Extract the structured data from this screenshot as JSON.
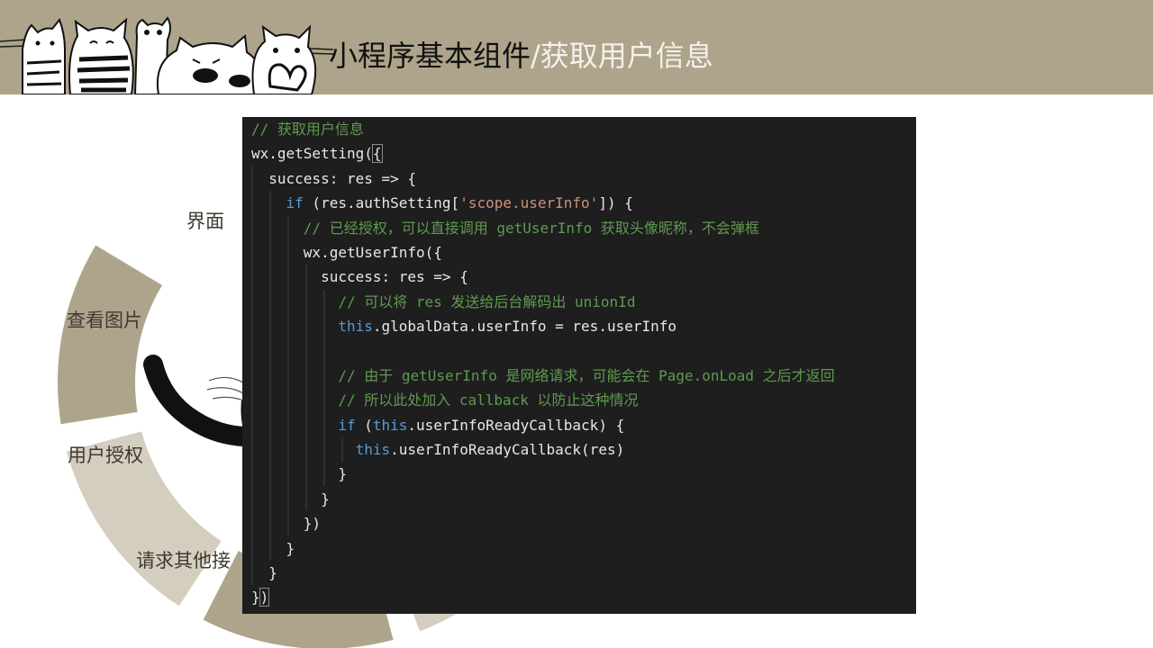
{
  "header": {
    "title_main": "小程序基本组件",
    "title_sep": "/",
    "title_sub": "获取用户信息"
  },
  "ring": {
    "segments": [
      {
        "label": "界面",
        "color": "#d4cebf"
      },
      {
        "label": "查看图片",
        "color": "#ada48b"
      },
      {
        "label": "用户授权",
        "color": "#d4cebf"
      },
      {
        "label": "请求其他接",
        "color": "#ada48b"
      }
    ]
  },
  "code": {
    "lines": [
      [
        {
          "t": "// 获取用户信息",
          "c": "comment"
        }
      ],
      [
        {
          "t": "wx.getSetting(",
          "c": "id"
        },
        {
          "t": "{",
          "c": "id"
        }
      ],
      [
        {
          "t": "  success: res => {",
          "c": "id"
        }
      ],
      [
        {
          "t": "    ",
          "c": "plain"
        },
        {
          "t": "if",
          "c": "kw"
        },
        {
          "t": " (res.authSetting[",
          "c": "id"
        },
        {
          "t": "'scope.userInfo'",
          "c": "str"
        },
        {
          "t": "]) {",
          "c": "id"
        }
      ],
      [
        {
          "t": "      // 已经授权，可以直接调用 getUserInfo 获取头像昵称，不会弹框",
          "c": "comment"
        }
      ],
      [
        {
          "t": "      wx.getUserInfo({",
          "c": "id"
        }
      ],
      [
        {
          "t": "        success: res => {",
          "c": "id"
        }
      ],
      [
        {
          "t": "          // 可以将 res 发送给后台解码出 unionId",
          "c": "comment"
        }
      ],
      [
        {
          "t": "          ",
          "c": "plain"
        },
        {
          "t": "this",
          "c": "kw"
        },
        {
          "t": ".globalData.userInfo = res.userInfo",
          "c": "id"
        }
      ],
      [
        {
          "t": "",
          "c": "plain"
        }
      ],
      [
        {
          "t": "          // 由于 getUserInfo 是网络请求，可能会在 Page.onLoad 之后才返回",
          "c": "comment"
        }
      ],
      [
        {
          "t": "          // 所以此处加入 callback 以防止这种情况",
          "c": "comment"
        }
      ],
      [
        {
          "t": "          ",
          "c": "plain"
        },
        {
          "t": "if",
          "c": "kw"
        },
        {
          "t": " (",
          "c": "id"
        },
        {
          "t": "this",
          "c": "kw"
        },
        {
          "t": ".userInfoReadyCallback) {",
          "c": "id"
        }
      ],
      [
        {
          "t": "            ",
          "c": "plain"
        },
        {
          "t": "this",
          "c": "kw"
        },
        {
          "t": ".userInfoReadyCallback(res)",
          "c": "id"
        }
      ],
      [
        {
          "t": "          }",
          "c": "id"
        }
      ],
      [
        {
          "t": "        }",
          "c": "id"
        }
      ],
      [
        {
          "t": "      })",
          "c": "id"
        }
      ],
      [
        {
          "t": "    }",
          "c": "id"
        }
      ],
      [
        {
          "t": "  }",
          "c": "id"
        }
      ],
      [
        {
          "t": "}",
          "c": "id"
        },
        {
          "t": ")",
          "c": "id"
        }
      ]
    ]
  }
}
